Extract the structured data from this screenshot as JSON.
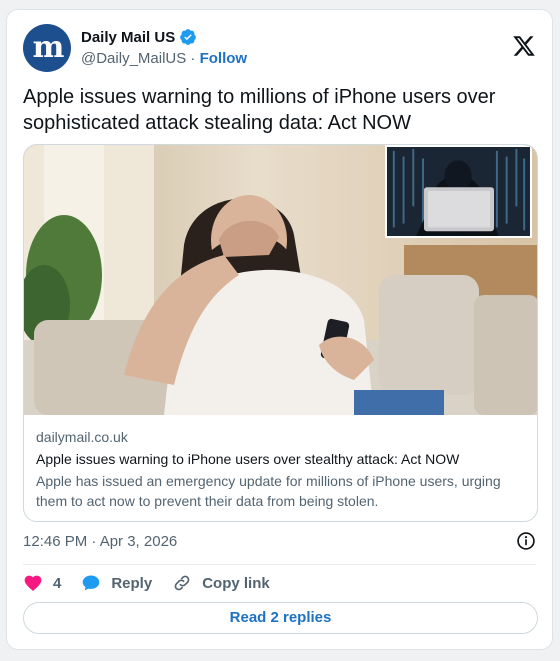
{
  "author": {
    "name": "Daily Mail US",
    "handle": "@Daily_MailUS",
    "separator": "·",
    "follow_label": "Follow",
    "avatar_letter": "m",
    "verified_icon": "verified-badge-icon",
    "brand_color": "#1d4f8f"
  },
  "tweet": {
    "text": "Apple issues warning to millions of iPhone users over sophisticated attack stealing data: Act NOW",
    "timestamp": "12:46 PM · Apr 3, 2026"
  },
  "link_card": {
    "domain": "dailymail.co.uk",
    "title": "Apple issues warning to iPhone users over stealthy attack: Act NOW",
    "description": "Apple has issued an emergency update for millions of iPhone users, urging them to act now to prevent their data from being stolen."
  },
  "actions": {
    "like_count": "4",
    "reply_label": "Reply",
    "copy_link_label": "Copy link"
  },
  "read_replies_label": "Read 2 replies",
  "colors": {
    "accent": "#1d72c2",
    "like": "#f91880",
    "muted": "#536471"
  }
}
